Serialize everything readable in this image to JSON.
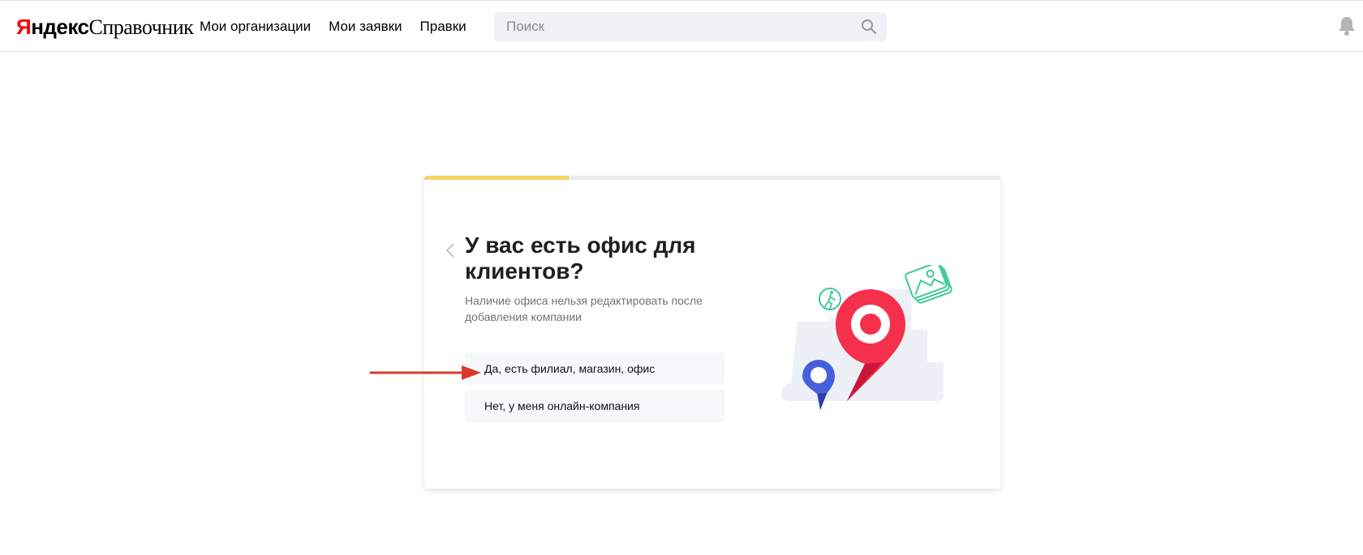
{
  "header": {
    "logo_part1": "Я",
    "logo_part2": "ндекс",
    "logo_part3": "Справочник",
    "nav": [
      "Мои организации",
      "Мои заявки",
      "Правки"
    ],
    "search_placeholder": "Поиск"
  },
  "card": {
    "progress_fraction": 0.25,
    "title": "У вас есть офис для клиентов?",
    "subtitle": "Наличие офиса нельзя редактировать после добавления компании",
    "options": [
      "Да, есть филиал, магазин, офис",
      "Нет, у меня онлайн-компания"
    ]
  },
  "colors": {
    "accent_yellow": "#f3d566",
    "pin_red": "#f5304d",
    "pin_blue": "#4660dc",
    "arrow_red": "#d93b2b",
    "icon_green": "#3fc79a"
  }
}
